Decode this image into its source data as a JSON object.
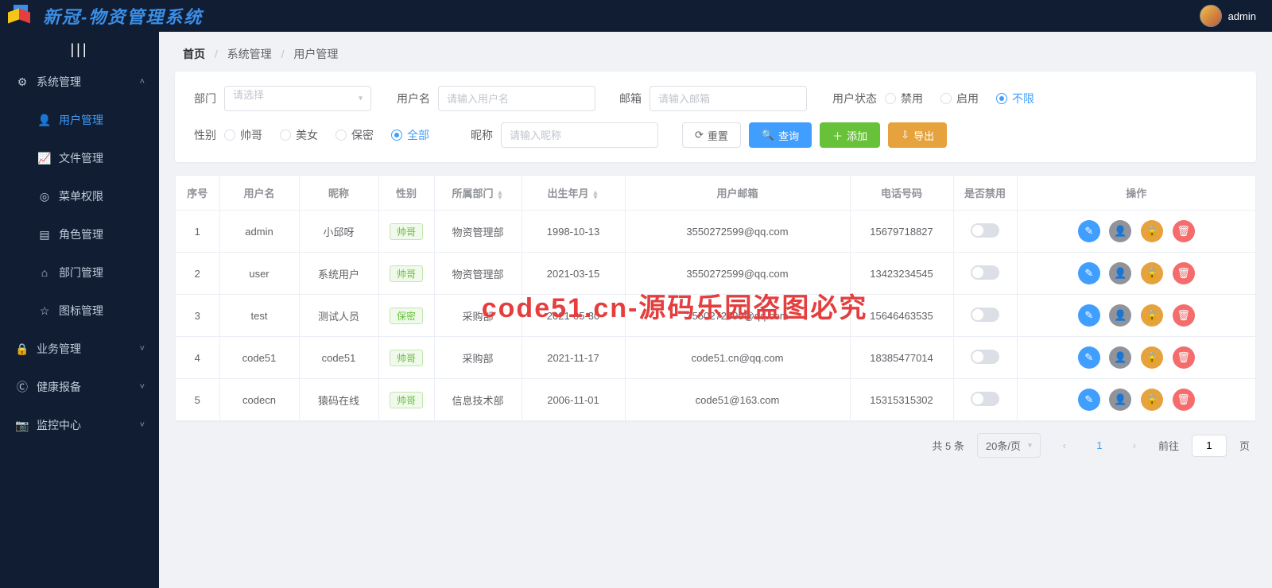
{
  "header": {
    "app_title": "新冠-物资管理系统",
    "username": "admin"
  },
  "sidebar": {
    "groups": [
      {
        "label": "系统管理",
        "open": true,
        "icon": "gear",
        "children": [
          {
            "label": "用户管理",
            "icon": "user",
            "active": true
          },
          {
            "label": "文件管理",
            "icon": "chart",
            "active": false
          },
          {
            "label": "菜单权限",
            "icon": "target",
            "active": false
          },
          {
            "label": "角色管理",
            "icon": "id",
            "active": false
          },
          {
            "label": "部门管理",
            "icon": "home",
            "active": false
          },
          {
            "label": "图标管理",
            "icon": "star",
            "active": false
          }
        ]
      },
      {
        "label": "业务管理",
        "open": false,
        "icon": "lock"
      },
      {
        "label": "健康报备",
        "open": false,
        "icon": "health"
      },
      {
        "label": "监控中心",
        "open": false,
        "icon": "camera"
      }
    ]
  },
  "breadcrumb": {
    "home": "首页",
    "group": "系统管理",
    "page": "用户管理"
  },
  "filter": {
    "dept_label": "部门",
    "dept_placeholder": "请选择",
    "username_label": "用户名",
    "username_placeholder": "请输入用户名",
    "email_label": "邮箱",
    "email_placeholder": "请输入邮箱",
    "status_label": "用户状态",
    "status_options": {
      "disabled": "禁用",
      "enabled": "启用",
      "all": "不限"
    },
    "status_selected": "all",
    "sex_label": "性别",
    "sex_options": {
      "m": "帅哥",
      "f": "美女",
      "s": "保密",
      "all": "全部"
    },
    "sex_selected": "all",
    "nick_label": "昵称",
    "nick_placeholder": "请输入昵称",
    "btn_reset": "重置",
    "btn_query": "查询",
    "btn_add": "添加",
    "btn_export": "导出"
  },
  "table": {
    "headers": {
      "idx": "序号",
      "username": "用户名",
      "nickname": "昵称",
      "sex": "性别",
      "dept": "所属部门",
      "birth": "出生年月",
      "email": "用户邮箱",
      "phone": "电话号码",
      "banned": "是否禁用",
      "ops": "操作"
    },
    "rows": [
      {
        "idx": "1",
        "username": "admin",
        "nickname": "小邱呀",
        "sex": "帅哥",
        "sex_cls": "green",
        "dept": "物资管理部",
        "birth": "1998-10-13",
        "email": "3550272599@qq.com",
        "phone": "15679718827"
      },
      {
        "idx": "2",
        "username": "user",
        "nickname": "系统用户",
        "sex": "帅哥",
        "sex_cls": "green",
        "dept": "物资管理部",
        "birth": "2021-03-15",
        "email": "3550272599@qq.com",
        "phone": "13423234545"
      },
      {
        "idx": "3",
        "username": "test",
        "nickname": "测试人员",
        "sex": "保密",
        "sex_cls": "green",
        "dept": "采购部",
        "birth": "2021-05-30",
        "email": "3550272599@qq.com",
        "phone": "15646463535"
      },
      {
        "idx": "4",
        "username": "code51",
        "nickname": "code51",
        "sex": "帅哥",
        "sex_cls": "green",
        "dept": "采购部",
        "birth": "2021-11-17",
        "email": "code51.cn@qq.com",
        "phone": "18385477014"
      },
      {
        "idx": "5",
        "username": "codecn",
        "nickname": "猿码在线",
        "sex": "帅哥",
        "sex_cls": "green",
        "dept": "信息技术部",
        "birth": "2006-11-01",
        "email": "code51@163.com",
        "phone": "15315315302"
      }
    ]
  },
  "pagination": {
    "total_text": "共 5 条",
    "per_page": "20条/页",
    "current": "1",
    "goto_prefix": "前往",
    "goto_suffix": "页",
    "goto_value": "1"
  },
  "watermark": "code51.cn-源码乐园盗图必究"
}
